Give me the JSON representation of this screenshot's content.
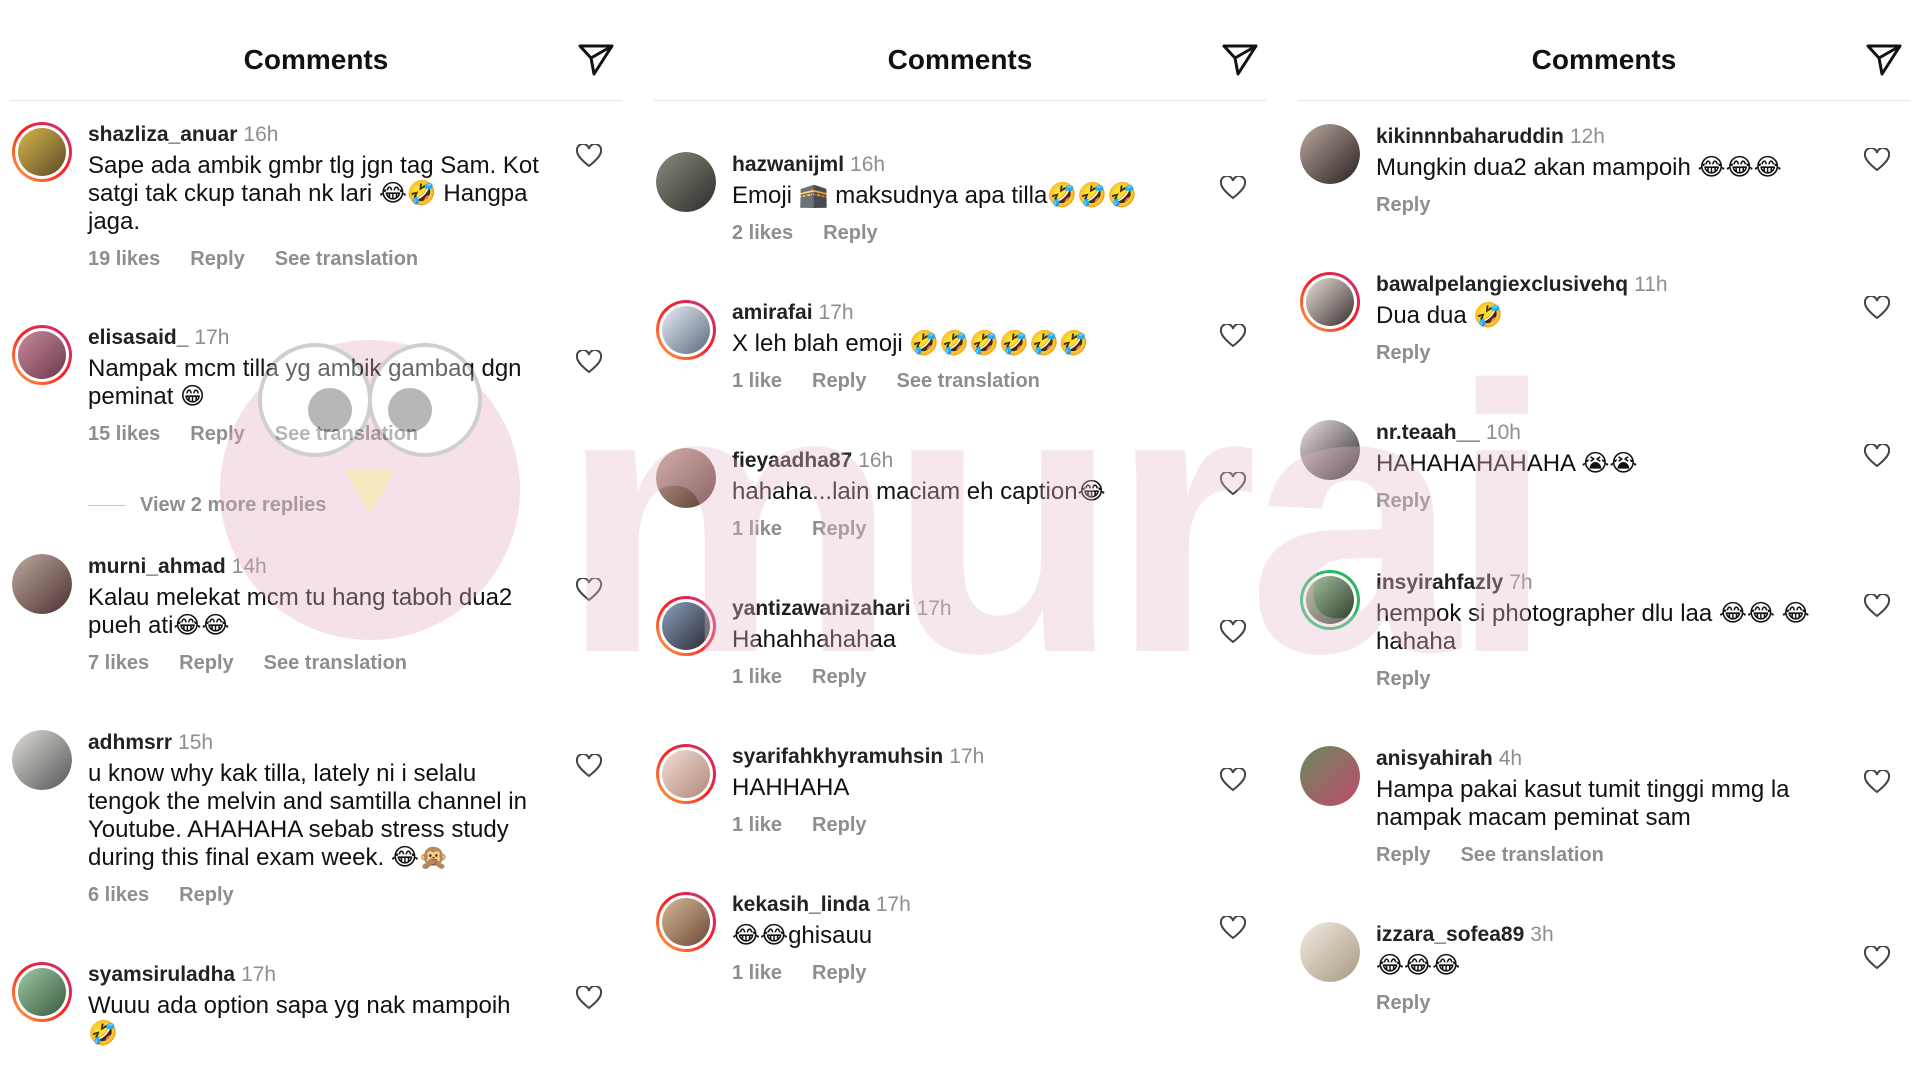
{
  "panels": [
    {
      "title": "Comments",
      "comments": [
        {
          "user": "shazliza_anuar",
          "time": "16h",
          "text": "Sape ada ambik gmbr tlg jgn tag Sam. Kot satgi tak ckup tanah nk lari 😂🤣 Hangpa jaga.",
          "likes": "19 likes",
          "reply": "Reply",
          "translation": "See translation"
        },
        {
          "user": "elisasaid_",
          "time": "17h",
          "text": "Nampak mcm tilla yg ambik gambaq dgn peminat 😁",
          "likes": "15 likes",
          "reply": "Reply",
          "translation": "See translation",
          "more_replies": "View 2 more replies"
        },
        {
          "user": "murni_ahmad",
          "time": "14h",
          "text": "Kalau melekat mcm tu hang taboh dua2 pueh ati😂😂",
          "likes": "7 likes",
          "reply": "Reply",
          "translation": "See translation"
        },
        {
          "user": "adhmsrr",
          "time": "15h",
          "text": "u know why kak tilla, lately ni i selalu tengok the melvin and samtilla channel in Youtube. AHAHAHA sebab stress study during this final exam week. 😂🙊",
          "likes": "6 likes",
          "reply": "Reply"
        },
        {
          "user": "syamsiruladha",
          "time": "17h",
          "text": "Wuuu ada option sapa yg nak mampoih 🤣"
        }
      ]
    },
    {
      "title": "Comments",
      "comments": [
        {
          "user": "hazwanijml",
          "time": "16h",
          "text": "Emoji 🕋 maksudnya apa tilla🤣🤣🤣",
          "likes": "2 likes",
          "reply": "Reply"
        },
        {
          "user": "amirafai",
          "time": "17h",
          "text": "X leh blah emoji 🤣🤣🤣🤣🤣🤣",
          "likes": "1 like",
          "reply": "Reply",
          "translation": "See translation"
        },
        {
          "user": "fieyaadha87",
          "time": "16h",
          "text": "hahaha...lain maciam eh caption😂",
          "likes": "1 like",
          "reply": "Reply"
        },
        {
          "user": "yantizawanizahari",
          "time": "17h",
          "text": "Hahahhahahaa",
          "likes": "1 like",
          "reply": "Reply"
        },
        {
          "user": "syarifahkhyramuhsin",
          "time": "17h",
          "text": "HAHHAHA",
          "likes": "1 like",
          "reply": "Reply"
        },
        {
          "user": "kekasih_linda",
          "time": "17h",
          "text": "😂😂ghisauu",
          "likes": "1 like",
          "reply": "Reply"
        }
      ]
    },
    {
      "title": "Comments",
      "comments": [
        {
          "user": "kikinnnbaharuddin",
          "time": "12h",
          "text": "Mungkin dua2 akan mampoih 😂😂😂",
          "reply": "Reply"
        },
        {
          "user": "bawalpelangiexclusivehq",
          "time": "11h",
          "text": "Dua dua 🤣",
          "reply": "Reply"
        },
        {
          "user": "nr.teaah__",
          "time": "10h",
          "text": "HAHAHAHAHAHA 😭😭",
          "reply": "Reply"
        },
        {
          "user": "insyirahfazly",
          "time": "7h",
          "text": "hempok si photographer dlu laa 😂😂 😂 hahaha",
          "reply": "Reply"
        },
        {
          "user": "anisyahirah",
          "time": "4h",
          "text": "Hampa pakai kasut tumit tinggi mmg la nampak macam peminat sam",
          "reply": "Reply",
          "translation": "See translation"
        },
        {
          "user": "izzara_sofea89",
          "time": "3h",
          "text": "😂😂😂",
          "reply": "Reply"
        }
      ]
    }
  ],
  "watermark": "murai",
  "colors": {
    "muted": "#8e8e8e",
    "ring_start": "#fcb045",
    "ring_end": "#c13584",
    "watermark": "#e7b8cc"
  }
}
